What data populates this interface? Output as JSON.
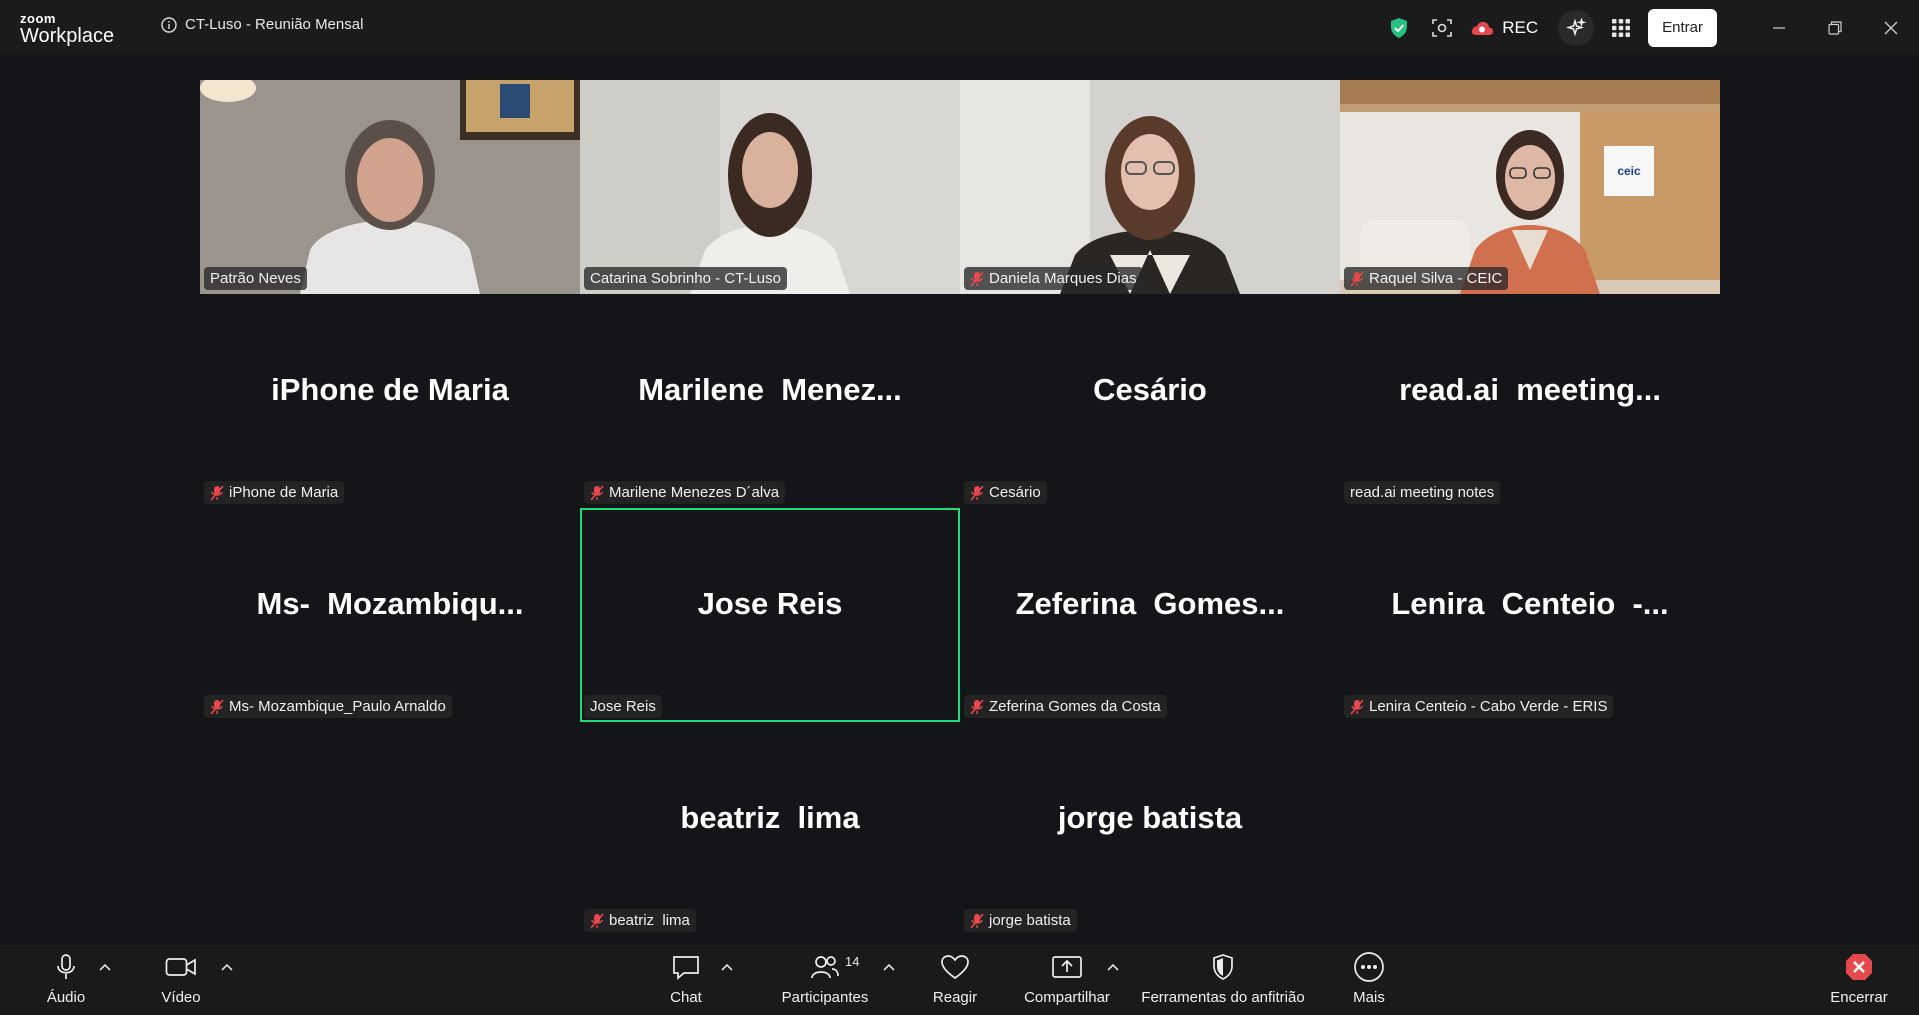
{
  "titlebar": {
    "logo_small": "zoom",
    "logo_big": "Workplace",
    "meeting_title": "CT-Luso - Reunião Mensal",
    "rec_label": "REC",
    "join_button": "Entrar"
  },
  "tiles": [
    {
      "name": "Patrão Neves",
      "big_name": "",
      "muted": false,
      "video": true
    },
    {
      "name": "Catarina Sobrinho - CT-Luso",
      "big_name": "",
      "muted": false,
      "video": true
    },
    {
      "name": "Daniela Marques Dias",
      "big_name": "",
      "muted": true,
      "video": true
    },
    {
      "name": "Raquel Silva - CEIC",
      "big_name": "",
      "muted": true,
      "video": true
    },
    {
      "name": "iPhone de Maria",
      "big_name": "iPhone de Maria",
      "muted": true,
      "video": false
    },
    {
      "name": "Marilene Menezes D´alva",
      "big_name": "Marilene  Menez...",
      "muted": true,
      "video": false
    },
    {
      "name": "Cesário",
      "big_name": "Cesário",
      "muted": true,
      "video": false
    },
    {
      "name": "read.ai meeting notes",
      "big_name": "read.ai  meeting...",
      "muted": false,
      "video": false
    },
    {
      "name": "Ms- Mozambique_Paulo Arnaldo",
      "big_name": "Ms-  Mozambiqu...",
      "muted": true,
      "video": false
    },
    {
      "name": "Jose Reis",
      "big_name": "Jose Reis",
      "muted": false,
      "video": false,
      "active": true
    },
    {
      "name": "Zeferina Gomes da Costa",
      "big_name": "Zeferina  Gomes...",
      "muted": true,
      "video": false
    },
    {
      "name": "Lenira Centeio - Cabo Verde - ERIS",
      "big_name": "Lenira  Centeio  -...",
      "muted": true,
      "video": false
    },
    {
      "name": "beatriz  lima",
      "big_name": "beatriz  lima",
      "muted": true,
      "video": false
    },
    {
      "name": "jorge batista",
      "big_name": "jorge batista",
      "muted": true,
      "video": false
    }
  ],
  "toolbar": {
    "audio": "Áudio",
    "video": "Vídeo",
    "chat": "Chat",
    "participants": "Participantes",
    "participant_count": "14",
    "react": "Reagir",
    "share": "Compartilhar",
    "host_tools": "Ferramentas do anfitrião",
    "more": "Mais",
    "end": "Encerrar"
  },
  "colors": {
    "active_speaker_border": "#23d97a",
    "security_shield": "#27c281",
    "rec_cloud": "#e5484d",
    "end_icon": "#e5484d",
    "stage_bg": "#131518"
  }
}
